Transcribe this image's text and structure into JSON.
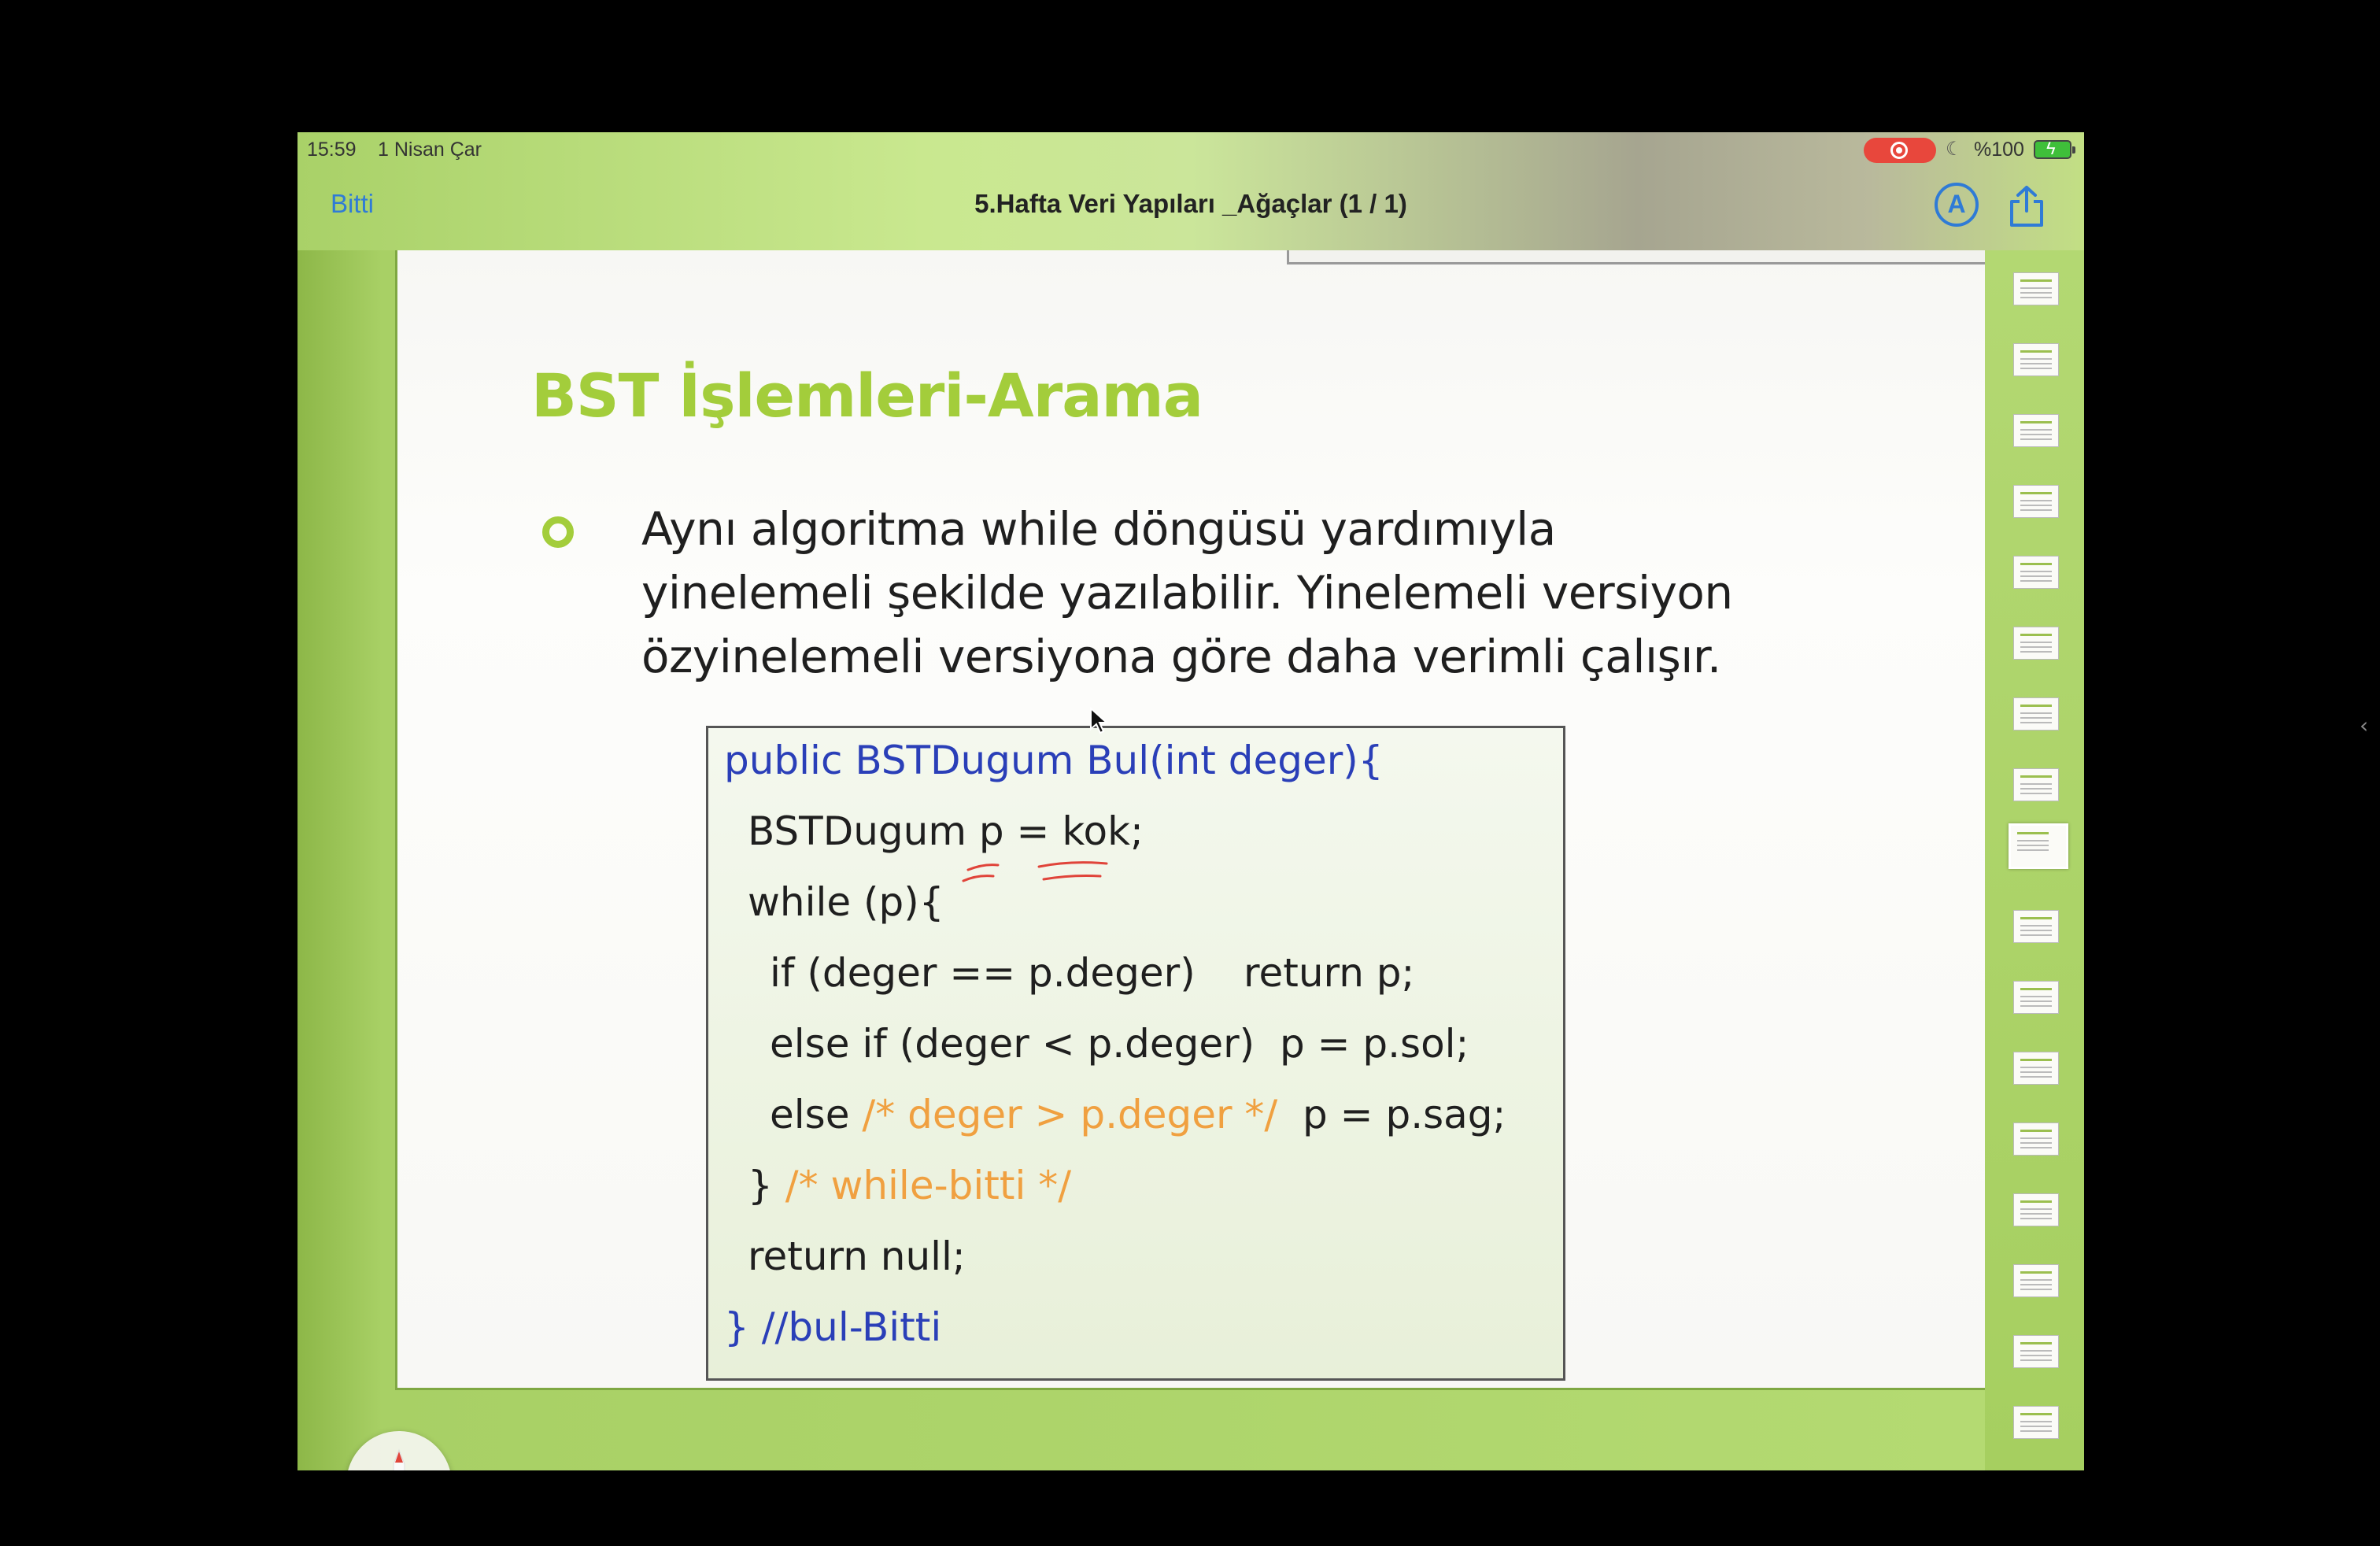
{
  "status_bar": {
    "time": "15:59",
    "date": "1 Nisan Çar",
    "battery": "%100"
  },
  "nav": {
    "done_label": "Bitti",
    "title": "5.Hafta Veri Yapıları _Ağaçlar (1 / 1)",
    "markup_icon": "markup-pen-icon",
    "share_icon": "share-icon"
  },
  "slide": {
    "title": "BST İşlemleri-Arama",
    "bullet_lines": [
      "Aynı algoritma while döngüsü yardımıyla",
      "yinelemeli şekilde yazılabilir. Yinelemeli versiyon",
      "özyinelemeli versiyona göre daha verimli çalışır."
    ],
    "code": {
      "line1": "public BSTDugum Bul(int deger){",
      "line2": "BSTDugum p = kok;",
      "line3": "while (p){",
      "line4a": "if (deger == p.deger)",
      "line4b": "return p;",
      "line5": "else if (deger < p.deger)  p = p.sol;",
      "line6a": "else ",
      "line6b": "/* deger > p.deger */",
      "line6c": "  p = p.sag;",
      "line7a": "} ",
      "line7b": "/* while-bitti */",
      "line8": "return null;",
      "line9": "} //bul-Bitti"
    }
  },
  "colors": {
    "accent_green": "#a3cd3b",
    "code_blue": "#2a3fb8",
    "comment_orange": "#f0a040",
    "ios_blue": "#2f7bd6",
    "annotation_red": "#e0443a"
  },
  "thumbnails": {
    "count": 17,
    "current_index": 8
  }
}
